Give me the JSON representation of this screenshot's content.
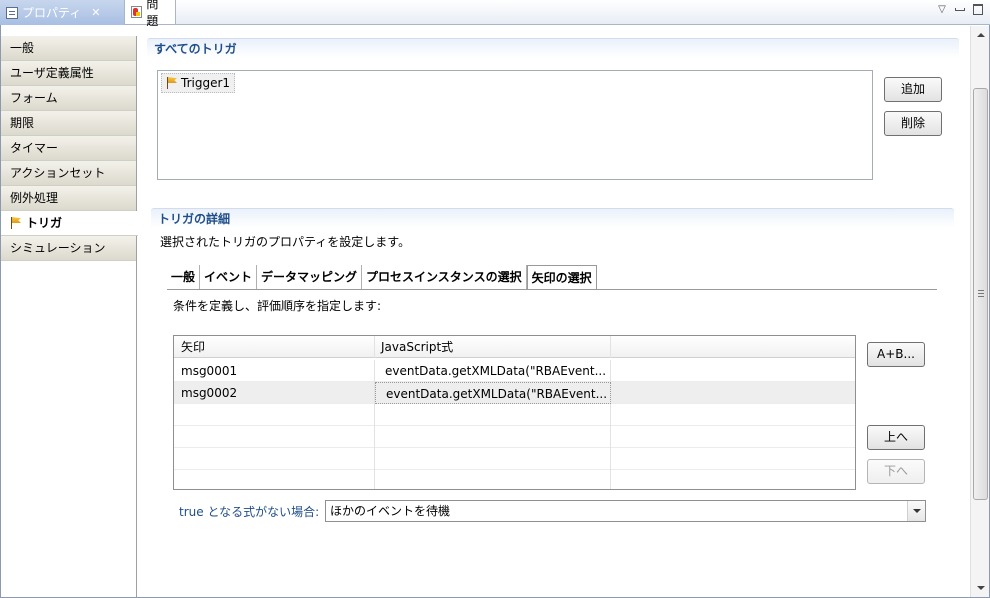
{
  "tabbar": {
    "properties_tab": "プロパティ",
    "problems_tab": "問題"
  },
  "sidebar": {
    "items": [
      {
        "label": "一般"
      },
      {
        "label": "ユーザ定義属性"
      },
      {
        "label": "フォーム"
      },
      {
        "label": "期限"
      },
      {
        "label": "タイマー"
      },
      {
        "label": "アクションセット"
      },
      {
        "label": "例外処理"
      },
      {
        "label": "トリガ",
        "active": true
      },
      {
        "label": "シミュレーション"
      }
    ]
  },
  "all_triggers": {
    "title": "すべてのトリガ",
    "items": [
      "Trigger1"
    ],
    "add_label": "追加",
    "delete_label": "削除"
  },
  "details": {
    "title": "トリガの詳細",
    "description": "選択されたトリガのプロパティを設定します。",
    "tabs": [
      "一般",
      "イベント",
      "データマッピング",
      "プロセスインスタンスの選択",
      "矢印の選択"
    ],
    "active_tab": "矢印の選択",
    "instructions": "条件を定義し、評価順序を指定します:",
    "table": {
      "headers": [
        "矢印",
        "JavaScript式",
        ""
      ],
      "rows": [
        {
          "arrow": "msg0001",
          "expr": "eventData.getXMLData(\"RBAEvent..."
        },
        {
          "arrow": "msg0002",
          "expr": "eventData.getXMLData(\"RBAEvent..."
        }
      ]
    },
    "expr_button": "A+B...",
    "up_button": "上へ",
    "down_button": "下へ",
    "no_true_label": "true となる式がない場合:",
    "no_true_value": "ほかのイベントを待機"
  }
}
